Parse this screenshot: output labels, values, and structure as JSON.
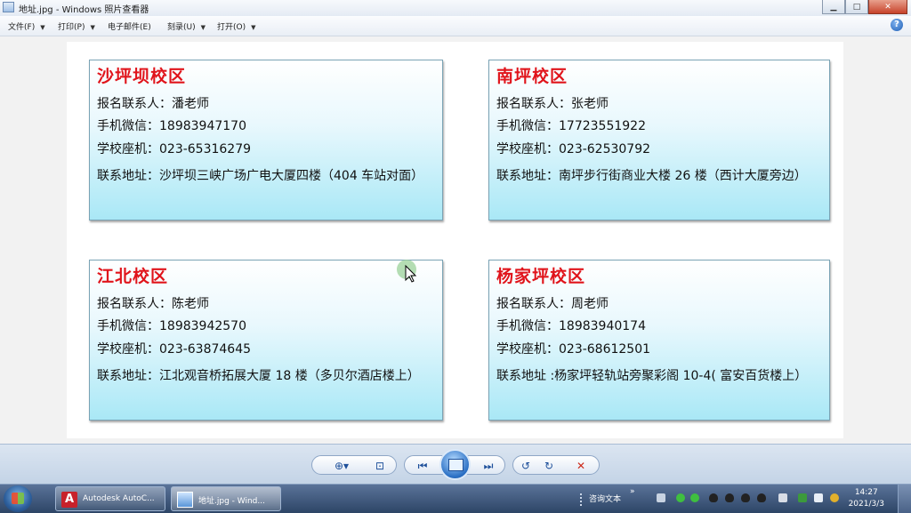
{
  "window": {
    "title": "地址.jpg - Windows 照片查看器",
    "minimize": "▁",
    "maximize": "□",
    "close": "✕"
  },
  "menu": {
    "items": [
      "文件(F)",
      "打印(P)",
      "电子邮件(E)",
      "刻录(U)",
      "打开(O)"
    ],
    "help": "?"
  },
  "photo": {
    "cards": [
      {
        "campus": "沙坪坝校区",
        "contact": "报名联系人：潘老师",
        "wechat": "手机微信：18983947170",
        "phone": "学校座机：023-65316279",
        "address": "联系地址：沙坪坝三峡广场广电大厦四楼（404 车站对面）"
      },
      {
        "campus": "南坪校区",
        "contact": "报名联系人：张老师",
        "wechat": "手机微信：17723551922",
        "phone": "学校座机：023-62530792",
        "address": "联系地址：南坪步行街商业大楼 26 楼（西计大厦旁边）"
      },
      {
        "campus": "江北校区",
        "contact": "报名联系人：陈老师",
        "wechat": "手机微信：18983942570",
        "phone": "学校座机：023-63874645",
        "address": "联系地址：江北观音桥拓展大厦 18 楼（多贝尔酒店楼上）"
      },
      {
        "campus": "杨家坪校区",
        "contact": "报名联系人：周老师",
        "wechat": "手机微信：18983940174",
        "phone": "学校座机：023-68612501",
        "address": "联系地址 :杨家坪轻轨站旁聚彩阁 10-4( 富安百货楼上）"
      }
    ]
  },
  "toolbar": {
    "zoom": "⊕▾",
    "actual_size": "⊡",
    "previous": "⏮",
    "next": "⏭",
    "rotate_ccw": "↺",
    "rotate_cw": "↻",
    "delete": "✕"
  },
  "taskbar": {
    "tasks": [
      {
        "label": "Autodesk AutoC...",
        "icon": "autocad-icon"
      },
      {
        "label": "地址.jpg - Wind...",
        "icon": "photo-viewer-icon"
      }
    ],
    "tray_label": "咨询文本",
    "time": "14:27",
    "date": "2021/3/3"
  },
  "colors": {
    "campus_red": "#e0141b",
    "card_gradient_bottom": "#a9e8f6",
    "close_red": "#c7432b"
  }
}
